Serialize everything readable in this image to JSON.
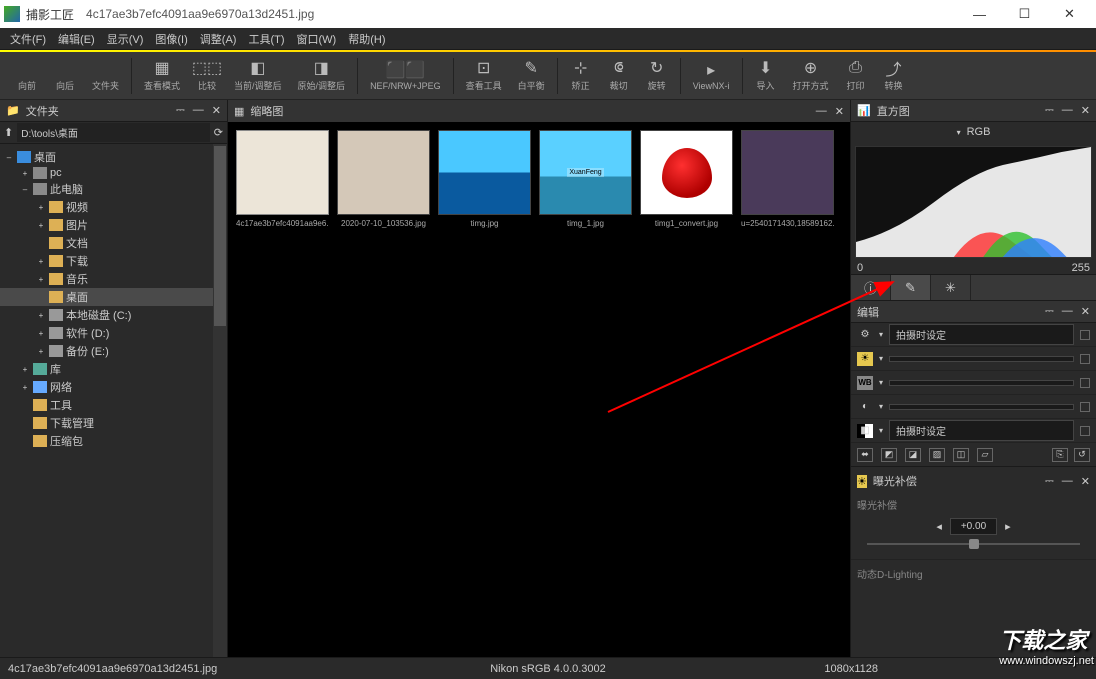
{
  "title": {
    "app": "捕影工匠",
    "file": "4c17ae3b7efc4091aa9e6970a13d2451.jpg"
  },
  "menu": [
    "文件(F)",
    "编辑(E)",
    "显示(V)",
    "图像(I)",
    "调整(A)",
    "工具(T)",
    "窗口(W)",
    "帮助(H)"
  ],
  "toolbar": [
    {
      "l": "向前",
      "g": ""
    },
    {
      "l": "向后",
      "g": ""
    },
    {
      "l": "文件夹",
      "g": ""
    },
    {
      "sep": true
    },
    {
      "l": "查看模式",
      "g": "▦"
    },
    {
      "l": "比较",
      "g": "⬚⬚"
    },
    {
      "l": "当前/调整后",
      "g": "◧"
    },
    {
      "l": "原始/调整后",
      "g": "◨"
    },
    {
      "sep": true
    },
    {
      "l": "NEF/NRW+JPEG",
      "g": "⬛⬛",
      "y": true
    },
    {
      "sep": true
    },
    {
      "l": "查看工具",
      "g": "⊡"
    },
    {
      "l": "白平衡",
      "g": "✎"
    },
    {
      "sep": true
    },
    {
      "l": "矫正",
      "g": "⊹"
    },
    {
      "l": "裁切",
      "g": "⟃"
    },
    {
      "l": "旋转",
      "g": "↻"
    },
    {
      "sep": true
    },
    {
      "l": "ViewNX-i",
      "g": "▸"
    },
    {
      "sep": true
    },
    {
      "l": "导入",
      "g": "⬇"
    },
    {
      "l": "打开方式",
      "g": "⊕"
    },
    {
      "l": "打印",
      "g": "⎙"
    },
    {
      "l": "转换",
      "g": "⤴"
    }
  ],
  "left": {
    "hdr": "文件夹",
    "path": "D:\\tools\\桌面",
    "tree": [
      {
        "t": "–",
        "i": "desk",
        "l": "桌面",
        "d": 0
      },
      {
        "t": "+",
        "i": "pc",
        "l": "pc",
        "d": 1
      },
      {
        "t": "–",
        "i": "pc",
        "l": "此电脑",
        "d": 1
      },
      {
        "t": "+",
        "i": "fold",
        "l": "视频",
        "d": 2
      },
      {
        "t": "+",
        "i": "fold",
        "l": "图片",
        "d": 2
      },
      {
        "t": "",
        "i": "fold",
        "l": "文档",
        "d": 2
      },
      {
        "t": "+",
        "i": "fold",
        "l": "下载",
        "d": 2
      },
      {
        "t": "+",
        "i": "fold",
        "l": "音乐",
        "d": 2
      },
      {
        "t": "",
        "i": "fold",
        "l": "桌面",
        "d": 2,
        "sel": true
      },
      {
        "t": "+",
        "i": "drv",
        "l": "本地磁盘 (C:)",
        "d": 2
      },
      {
        "t": "+",
        "i": "drv",
        "l": "软件 (D:)",
        "d": 2
      },
      {
        "t": "+",
        "i": "drv",
        "l": "备份 (E:)",
        "d": 2
      },
      {
        "t": "+",
        "i": "lib",
        "l": "库",
        "d": 1
      },
      {
        "t": "+",
        "i": "net",
        "l": "网络",
        "d": 1
      },
      {
        "t": "",
        "i": "fold",
        "l": "工具",
        "d": 1
      },
      {
        "t": "",
        "i": "fold",
        "l": "下载管理",
        "d": 1
      },
      {
        "t": "",
        "i": "fold",
        "l": "压缩包",
        "d": 1
      }
    ]
  },
  "center": {
    "hdr": "缩略图",
    "thumbs": [
      {
        "c": "4c17ae3b7efc4091aa9e6...",
        "sel": true,
        "bg": "#ece5d8"
      },
      {
        "c": "2020-07-10_103536.jpg",
        "bg": "#d4c8b8"
      },
      {
        "c": "timg.jpg",
        "bg": "linear-gradient(#4ac8ff 50%,#0a5a9f 50%)"
      },
      {
        "c": "timg_1.jpg",
        "bg": "linear-gradient(#5ad0ff 55%,#2a8aaf 55%)"
      },
      {
        "c": "timg1_convert.jpg",
        "bg": "#fff"
      },
      {
        "c": "u=2540171430,18589162...",
        "bg": "#4a3a5a"
      }
    ]
  },
  "right": {
    "hist": "直方图",
    "rgb": "RGB",
    "smin": "0",
    "smax": "255",
    "editlbl": "编辑",
    "rows": [
      {
        "ic": "⚙",
        "sel": "拍摄时设定"
      },
      {
        "ic": "☀",
        "y": true,
        "sel": ""
      },
      {
        "ic": "WB",
        "wb": true,
        "sel": ""
      },
      {
        "ic": "◐",
        "sel": ""
      },
      {
        "ic": "◧",
        "bw": true,
        "sel": "拍摄时设定"
      }
    ],
    "exp": {
      "hdr": "曝光补偿",
      "lbl": "曝光补偿",
      "val": "+0.00"
    },
    "dl": "动态D-Lighting"
  },
  "status": {
    "l": "4c17ae3b7efc4091aa9e6970a13d2451.jpg",
    "c": "Nikon sRGB 4.0.0.3002",
    "r": "1080x1128"
  },
  "wm": {
    "cn": "下载之家",
    "url": "www.windowszj.net"
  }
}
